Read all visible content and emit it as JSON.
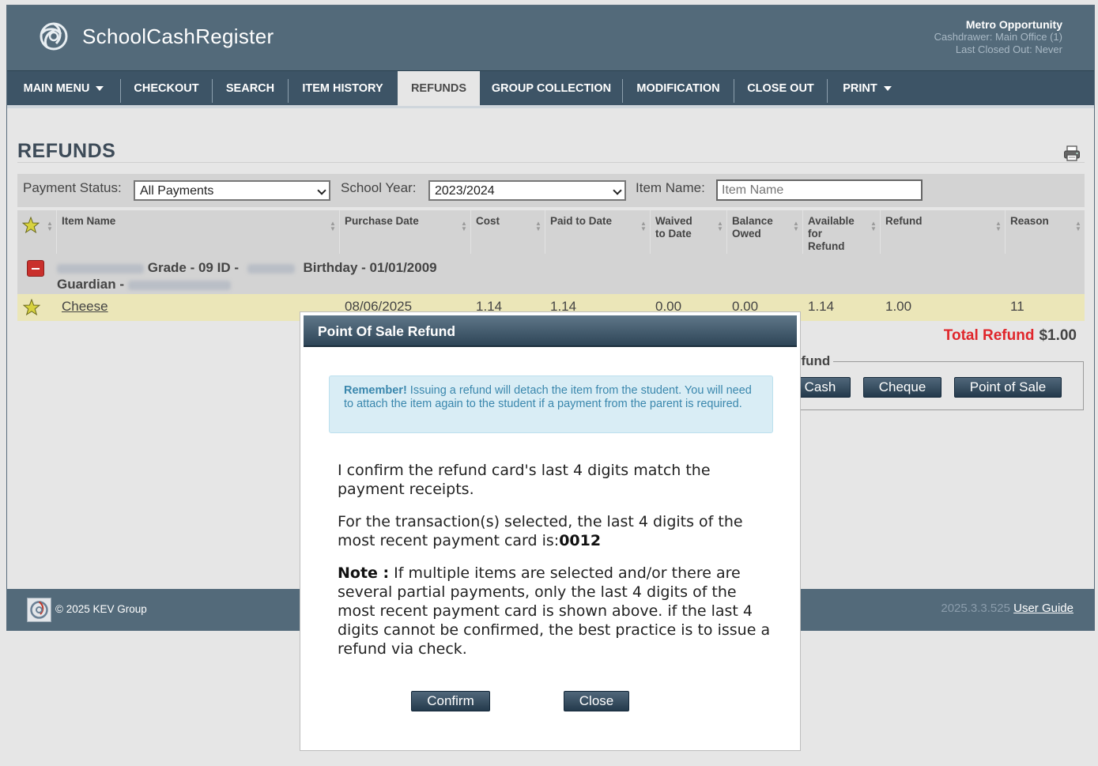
{
  "app": {
    "brand": "SchoolCashRegister",
    "org": "Metro Opportunity",
    "cashdrawer": "Cashdrawer: Main Office (1)",
    "last_closed": "Last Closed Out: Never"
  },
  "nav": {
    "items": [
      {
        "label": "MAIN MENU"
      },
      {
        "label": "CHECKOUT"
      },
      {
        "label": "SEARCH"
      },
      {
        "label": "ITEM HISTORY"
      },
      {
        "label": "REFUNDS"
      },
      {
        "label": "GROUP COLLECTION"
      },
      {
        "label": "MODIFICATION"
      },
      {
        "label": "CLOSE OUT"
      },
      {
        "label": "PRINT"
      }
    ],
    "active": "REFUNDS"
  },
  "page": {
    "title": "REFUNDS"
  },
  "filters": {
    "payment_status_label": "Payment Status:",
    "payment_status_value": "All Payments",
    "school_year_label": "School Year:",
    "school_year_value": "2023/2024",
    "item_name_label": "Item Name:",
    "item_name_placeholder": "Item Name"
  },
  "table": {
    "columns": [
      "Item Name",
      "Purchase Date",
      "Cost",
      "Paid to Date",
      "Waived to Date",
      "Balance Owed",
      "Available for Refund",
      "Refund",
      "Reason"
    ],
    "group": {
      "grade": "Grade - 09 ID -",
      "birthday": "Birthday - 01/01/2009",
      "guardian": "Guardian -"
    },
    "rows": [
      {
        "item_name": "Cheese",
        "purchase_date": "08/06/2025",
        "cost": "1.14",
        "paid_to_date": "1.14",
        "waived_to_date": "0.00",
        "balance_owed": "0.00",
        "available_for_refund": "1.14",
        "refund": "1.00",
        "reason": "11"
      }
    ]
  },
  "totals": {
    "label": "Total Refund",
    "value": "$1.00"
  },
  "refund_panel": {
    "legend": "efund",
    "buttons": [
      "Cash",
      "Cheque",
      "Point of Sale"
    ]
  },
  "footer": {
    "copyright": "© 2025 KEV Group",
    "version": "2025.3.3.525",
    "guide_link": "User Guide"
  },
  "modal": {
    "title": "Point Of Sale Refund",
    "alert_strong": "Remember!",
    "alert_text": " Issuing a refund will detach the item from the student. You will need to attach the item again to the student if a payment from the parent is required.",
    "confirm_text": "I confirm the refund card's last 4 digits match the payment receipts.",
    "digits_text": "For the transaction(s) selected, the last 4 digits of the most recent payment card is:",
    "digits_value": "0012",
    "note_label": "Note :",
    "note_text": " If multiple items are selected and/or there are several partial payments, only the last 4 digits of the most recent payment card is shown above. if the last 4 digits cannot be confirmed, the best practice is to issue a refund via check.",
    "confirm_button": "Confirm",
    "close_button": "Close"
  }
}
